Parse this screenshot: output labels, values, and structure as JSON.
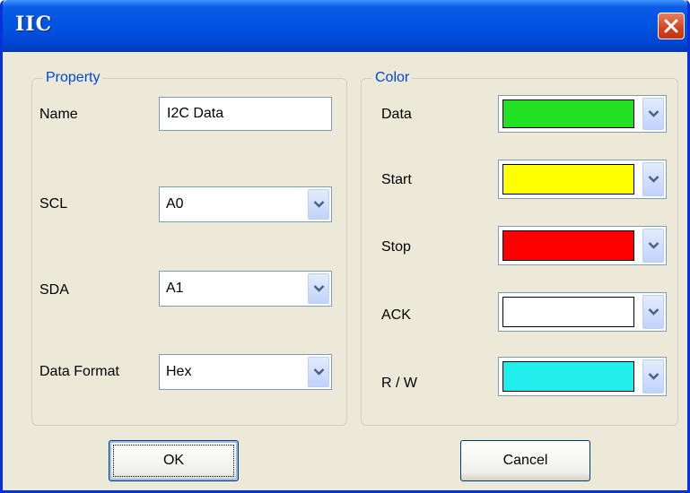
{
  "window": {
    "title": "IIC"
  },
  "property_group": {
    "title": "Property",
    "name_label": "Name",
    "name_value": "I2C Data",
    "scl_label": "SCL",
    "scl_value": "A0",
    "sda_label": "SDA",
    "sda_value": "A1",
    "format_label": "Data Format",
    "format_value": "Hex"
  },
  "color_group": {
    "title": "Color",
    "items": [
      {
        "label": "Data",
        "color": "#22e022"
      },
      {
        "label": "Start",
        "color": "#ffff00"
      },
      {
        "label": "Stop",
        "color": "#ff0000"
      },
      {
        "label": "ACK",
        "color": "#ffffff"
      },
      {
        "label": "R / W",
        "color": "#22eeee"
      }
    ]
  },
  "buttons": {
    "ok": "OK",
    "cancel": "Cancel"
  }
}
